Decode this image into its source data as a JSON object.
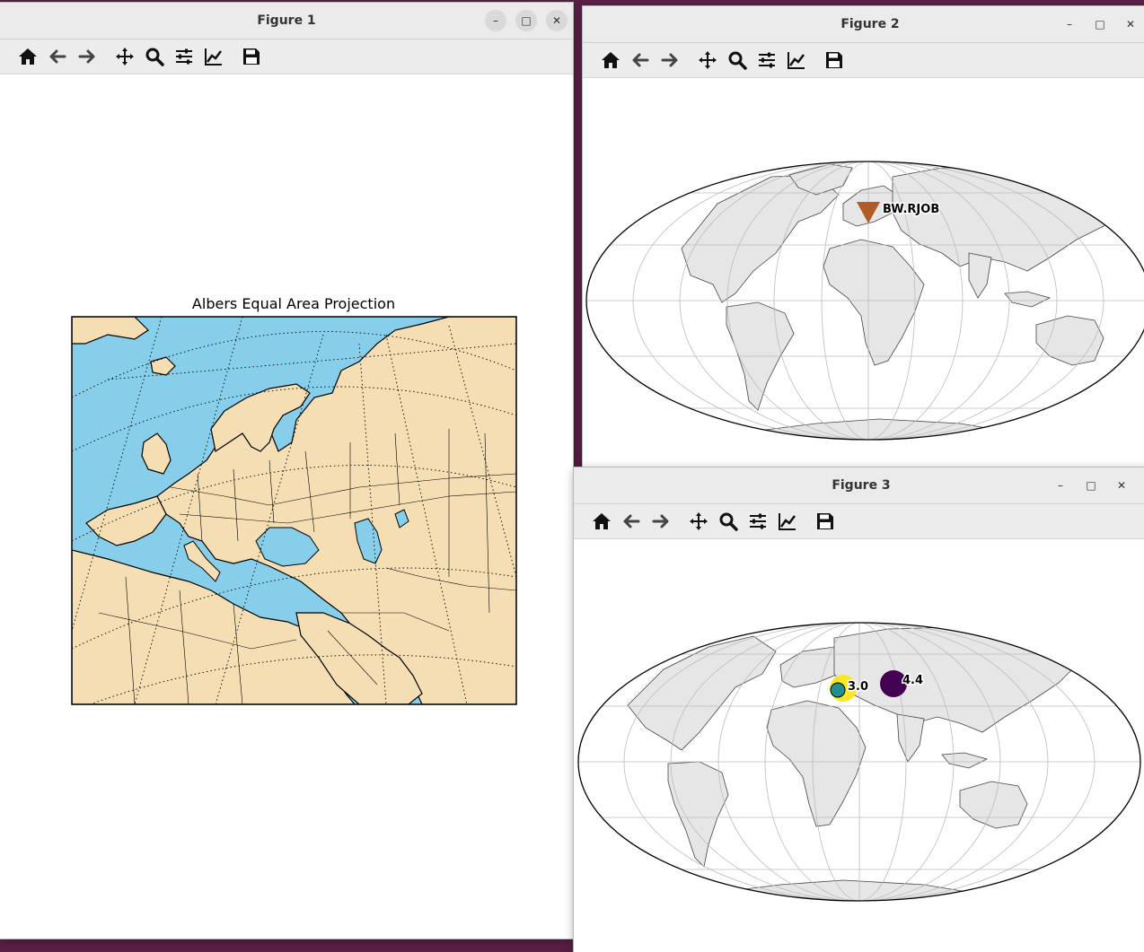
{
  "windows": {
    "fig1": {
      "title": "Figure 1"
    },
    "fig2": {
      "title": "Figure 2"
    },
    "fig3": {
      "title": "Figure 3"
    }
  },
  "toolbar": {
    "icons": [
      "home-icon",
      "back-arrow-icon",
      "forward-arrow-icon",
      "pan-move-icon",
      "zoom-magnifier-icon",
      "configure-subplots-icon",
      "edit-axes-icon",
      "save-floppy-icon"
    ]
  },
  "window_controls": {
    "minimize": "–",
    "maximize": "□",
    "close": "✕"
  },
  "colors": {
    "ocean": "#87ceeb",
    "land_fig1": "#f5deb3",
    "land_world": "#e6e6e6",
    "station_marker": "#b35a2a",
    "event_yellow": "#fde725",
    "event_teal": "#21908d",
    "event_purple": "#440154"
  },
  "figure1": {
    "title": "Albers Equal Area Projection"
  },
  "figure2": {
    "station_label": "BW.RJOB"
  },
  "figure3": {
    "event_labels": [
      "3.0",
      "4.4"
    ]
  }
}
